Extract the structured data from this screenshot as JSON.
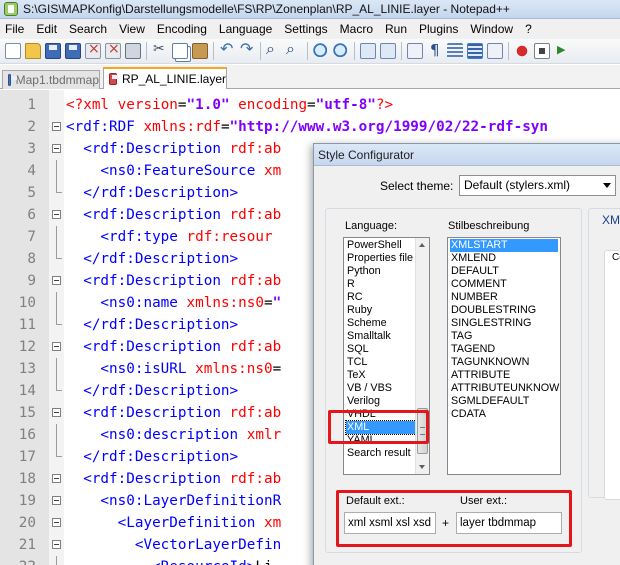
{
  "window": {
    "title": "S:\\GIS\\MAPKonfig\\Darstellungsmodelle\\FS\\RP\\Zonenplan\\RP_AL_LINIE.layer - Notepad++"
  },
  "menu": [
    "File",
    "Edit",
    "Search",
    "View",
    "Encoding",
    "Language",
    "Settings",
    "Macro",
    "Run",
    "Plugins",
    "Window",
    "?"
  ],
  "toolbar": {
    "icons": [
      "new-file-icon",
      "open-folder-icon",
      "save-icon",
      "save-all-icon",
      "close-icon",
      "close-all-icon",
      "print-icon",
      "cut-icon",
      "copy-icon",
      "paste-icon",
      "undo-icon",
      "redo-icon",
      "find-icon",
      "replace-icon",
      "zoom-in-icon",
      "zoom-out-icon",
      "sync-vertical-icon",
      "sync-horizontal-icon",
      "word-wrap-icon",
      "show-all-characters-icon",
      "indent-guide-icon",
      "user-defined-language-icon",
      "doc-map-icon",
      "record-macro-icon",
      "stop-recording-icon",
      "play-macro-icon"
    ]
  },
  "tabs": [
    {
      "label": "Map1.tbdmmap",
      "state": "inactive"
    },
    {
      "label": "RP_AL_LINIE.layer",
      "state": "active"
    }
  ],
  "editor": {
    "lines": [
      {
        "n": "1",
        "tokens": [
          {
            "t": "<?xml ",
            "c": "decl"
          },
          {
            "t": "version",
            "c": "attr"
          },
          {
            "t": "=",
            "c": "txt"
          },
          {
            "t": "\"1.0\"",
            "c": "str"
          },
          {
            "t": " encoding",
            "c": "attr"
          },
          {
            "t": "=",
            "c": "txt"
          },
          {
            "t": "\"utf-8\"",
            "c": "str"
          },
          {
            "t": "?>",
            "c": "decl"
          }
        ]
      },
      {
        "n": "2",
        "tokens": [
          {
            "t": "<rdf:RDF ",
            "c": "tag"
          },
          {
            "t": "xmlns:rdf",
            "c": "attr"
          },
          {
            "t": "=",
            "c": "txt"
          },
          {
            "t": "\"http://www.w3.org/1999/02/22-rdf-syn",
            "c": "str"
          }
        ]
      },
      {
        "n": "3",
        "tokens": [
          {
            "t": "  <rdf:Description ",
            "c": "tag"
          },
          {
            "t": "rdf:ab",
            "c": "attr"
          }
        ]
      },
      {
        "n": "4",
        "tokens": [
          {
            "t": "    <ns0:FeatureSource ",
            "c": "tag"
          },
          {
            "t": "xm",
            "c": "attr"
          }
        ]
      },
      {
        "n": "5",
        "tokens": [
          {
            "t": "  </rdf:Description>",
            "c": "tag"
          }
        ]
      },
      {
        "n": "6",
        "tokens": [
          {
            "t": "  <rdf:Description ",
            "c": "tag"
          },
          {
            "t": "rdf:ab",
            "c": "attr"
          }
        ]
      },
      {
        "n": "7",
        "tokens": [
          {
            "t": "    <rdf:type ",
            "c": "tag"
          },
          {
            "t": "rdf:resour",
            "c": "attr"
          }
        ]
      },
      {
        "n": "8",
        "tokens": [
          {
            "t": "  </rdf:Description>",
            "c": "tag"
          }
        ]
      },
      {
        "n": "9",
        "tokens": [
          {
            "t": "  <rdf:Description ",
            "c": "tag"
          },
          {
            "t": "rdf:ab",
            "c": "attr"
          }
        ]
      },
      {
        "n": "10",
        "tokens": [
          {
            "t": "    <ns0:name ",
            "c": "tag"
          },
          {
            "t": "xmlns:ns0",
            "c": "attr"
          },
          {
            "t": "=",
            "c": "txt"
          },
          {
            "t": "\"",
            "c": "str"
          }
        ]
      },
      {
        "n": "11",
        "tokens": [
          {
            "t": "  </rdf:Description>",
            "c": "tag"
          }
        ]
      },
      {
        "n": "12",
        "tokens": [
          {
            "t": "  <rdf:Description ",
            "c": "tag"
          },
          {
            "t": "rdf:ab",
            "c": "attr"
          }
        ]
      },
      {
        "n": "13",
        "tokens": [
          {
            "t": "    <ns0:isURL ",
            "c": "tag"
          },
          {
            "t": "xmlns:ns0",
            "c": "attr"
          },
          {
            "t": "=",
            "c": "txt"
          }
        ]
      },
      {
        "n": "14",
        "tokens": [
          {
            "t": "  </rdf:Description>",
            "c": "tag"
          }
        ]
      },
      {
        "n": "15",
        "tokens": [
          {
            "t": "  <rdf:Description ",
            "c": "tag"
          },
          {
            "t": "rdf:ab",
            "c": "attr"
          }
        ]
      },
      {
        "n": "16",
        "tokens": [
          {
            "t": "    <ns0:description ",
            "c": "tag"
          },
          {
            "t": "xmlr",
            "c": "attr"
          }
        ]
      },
      {
        "n": "17",
        "tokens": [
          {
            "t": "  </rdf:Description>",
            "c": "tag"
          }
        ]
      },
      {
        "n": "18",
        "tokens": [
          {
            "t": "  <rdf:Description ",
            "c": "tag"
          },
          {
            "t": "rdf:ab",
            "c": "attr"
          }
        ]
      },
      {
        "n": "19",
        "tokens": [
          {
            "t": "    <ns0:LayerDefinitionR",
            "c": "tag"
          }
        ]
      },
      {
        "n": "20",
        "tokens": [
          {
            "t": "      <LayerDefinition ",
            "c": "tag"
          },
          {
            "t": "xm",
            "c": "attr"
          }
        ]
      },
      {
        "n": "21",
        "tokens": [
          {
            "t": "        <VectorLayerDefin",
            "c": "tag"
          }
        ]
      },
      {
        "n": "22",
        "tokens": [
          {
            "t": "          <ResourceId>",
            "c": "tag"
          },
          {
            "t": "Li",
            "c": "txt"
          }
        ]
      }
    ]
  },
  "dialog": {
    "title": "Style Configurator",
    "select_theme_label": "Select theme:",
    "theme_value": "Default (stylers.xml)",
    "language_label": "Language:",
    "style_label": "Stilbeschreibung",
    "right_header": "XML",
    "right_partial": "Co",
    "languages": [
      "PowerShell",
      "Properties file",
      "Python",
      "R",
      "RC",
      "Ruby",
      "Scheme",
      "Smalltalk",
      "SQL",
      "TCL",
      "TeX",
      "VB / VBS",
      "Verilog",
      "VHDL",
      "XML",
      "YAML",
      "Search result"
    ],
    "selected_language": "XML",
    "styles": [
      "XMLSTART",
      "XMLEND",
      "DEFAULT",
      "COMMENT",
      "NUMBER",
      "DOUBLESTRING",
      "SINGLESTRING",
      "TAG",
      "TAGEND",
      "TAGUNKNOWN",
      "ATTRIBUTE",
      "ATTRIBUTEUNKNOWN",
      "SGMLDEFAULT",
      "CDATA"
    ],
    "selected_style": "XMLSTART",
    "default_ext_label": "Default ext.:",
    "default_ext_value": "xml xsml xsl xsd k",
    "plus_sign": "+",
    "user_ext_label": "User ext.:",
    "user_ext_value": "layer tbdmmap"
  },
  "colors": {
    "tag": "#0000ff",
    "attribute": "#ff0000",
    "string": "#8000ff",
    "selection": "#3399ff",
    "highlight_box": "#e3161c"
  }
}
